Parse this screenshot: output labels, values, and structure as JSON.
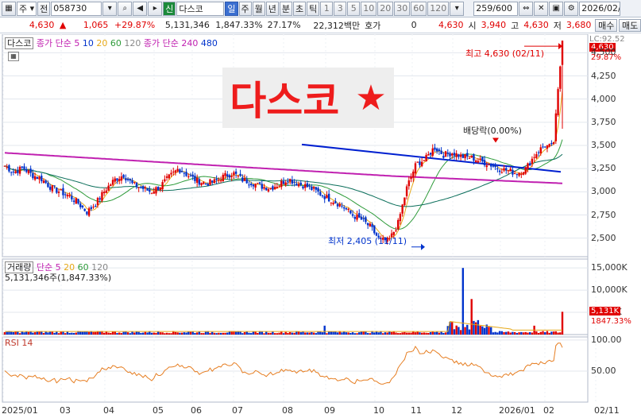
{
  "toolbar": {
    "market_sel": "주",
    "prev_label": "전",
    "code": "058730",
    "tag": "신",
    "name": "다스코",
    "periods": [
      "일",
      "주",
      "월",
      "년",
      "분",
      "초",
      "틱"
    ],
    "intervals": [
      "1",
      "3",
      "5",
      "10",
      "20",
      "30",
      "60",
      "120"
    ],
    "count": "259",
    "count_max": "/600",
    "date": "2026/02/"
  },
  "quote": {
    "price": "4,630",
    "change": "1,065",
    "change_pct": "+29.87%",
    "volume": "5,131,346",
    "vol_pct": "1,847.33%",
    "turnover": "27.17%",
    "amount": "22,312백만",
    "hoga_label": "호가",
    "hoga_val": "0",
    "hoga_price": "4,630",
    "open_label": "시",
    "open": "3,940",
    "high_label": "고",
    "high": "4,630",
    "low_label": "저",
    "low": "3,680",
    "buy": "매수",
    "sell": "매도"
  },
  "price_panel": {
    "legend_name": "다스코",
    "legend_ma": "종가 단순",
    "legend_ma_periods": [
      "5",
      "10",
      "20",
      "60",
      "120"
    ],
    "legend_ma2": "종가 단순",
    "legend_ma2_periods": [
      "240",
      "480"
    ],
    "title_overlay": "다스코",
    "star": "★",
    "high_note": "최고 4,630 (02/11)",
    "low_note": "최저 2,405 (11/11)",
    "div_note": "배당락(0.00%)",
    "lc_label": "LC:92.52",
    "last_price_tag": "4,630",
    "last_pct_tag": "29.87%"
  },
  "volume_panel": {
    "legend": "거래량",
    "legend_ma": "단순",
    "legend_periods": [
      "5",
      "20",
      "60",
      "120"
    ],
    "value_text": "5,131,346주(1,847.33%)",
    "tag_value": "5,131K",
    "tag_pct": "1847.33%"
  },
  "rsi_panel": {
    "legend": "RSI 14"
  },
  "chart_data": [
    {
      "type": "candlestick",
      "title": "다스코",
      "yticks": [
        "4,500",
        "4,250",
        "4,000",
        "3,750",
        "3,500",
        "3,250",
        "3,000",
        "2,750",
        "2,500"
      ],
      "ylim": [
        2300,
        4700
      ],
      "xticks": [
        "2025/01",
        "03",
        "04",
        "05",
        "06",
        "07",
        "08",
        "09",
        "10",
        "11",
        "12",
        "2026/01",
        "02",
        "02/11"
      ],
      "high": {
        "value": 4630,
        "date": "02/11"
      },
      "low": {
        "value": 2405,
        "date": "11/11"
      },
      "close_path": [
        3280,
        3210,
        3260,
        3180,
        3140,
        3050,
        3000,
        2960,
        2880,
        2780,
        2880,
        3020,
        3130,
        3180,
        3080,
        3040,
        3000,
        3060,
        3160,
        3250,
        3180,
        3120,
        3090,
        3110,
        3170,
        3200,
        3130,
        3100,
        3060,
        3040,
        3080,
        3140,
        3090,
        3060,
        3010,
        2950,
        2900,
        2840,
        2750,
        2700,
        2620,
        2480,
        2470,
        2650,
        3050,
        3300,
        3350,
        3480,
        3400,
        3420,
        3380,
        3370,
        3330,
        3300,
        3250,
        3230,
        3200,
        3250,
        3400,
        3500,
        3480,
        4630
      ]
    },
    {
      "type": "bar",
      "title": "거래량",
      "yticks": [
        "15,000K",
        "10,000K",
        "5,000K"
      ],
      "ylim": [
        0,
        17000
      ],
      "last_value": 5131
    },
    {
      "type": "line",
      "title": "RSI 14",
      "yticks": [
        "100.00",
        "50.00"
      ],
      "ylim": [
        0,
        105
      ]
    }
  ],
  "colors": {
    "up": "#e00000",
    "down": "#0033cc",
    "ma5": "#e6a817",
    "ma20": "#2e9b3a",
    "ma60": "#0a6e5a",
    "ma240": "#c020b0",
    "trend": "#0020d0",
    "rsi": "#e67e22"
  }
}
